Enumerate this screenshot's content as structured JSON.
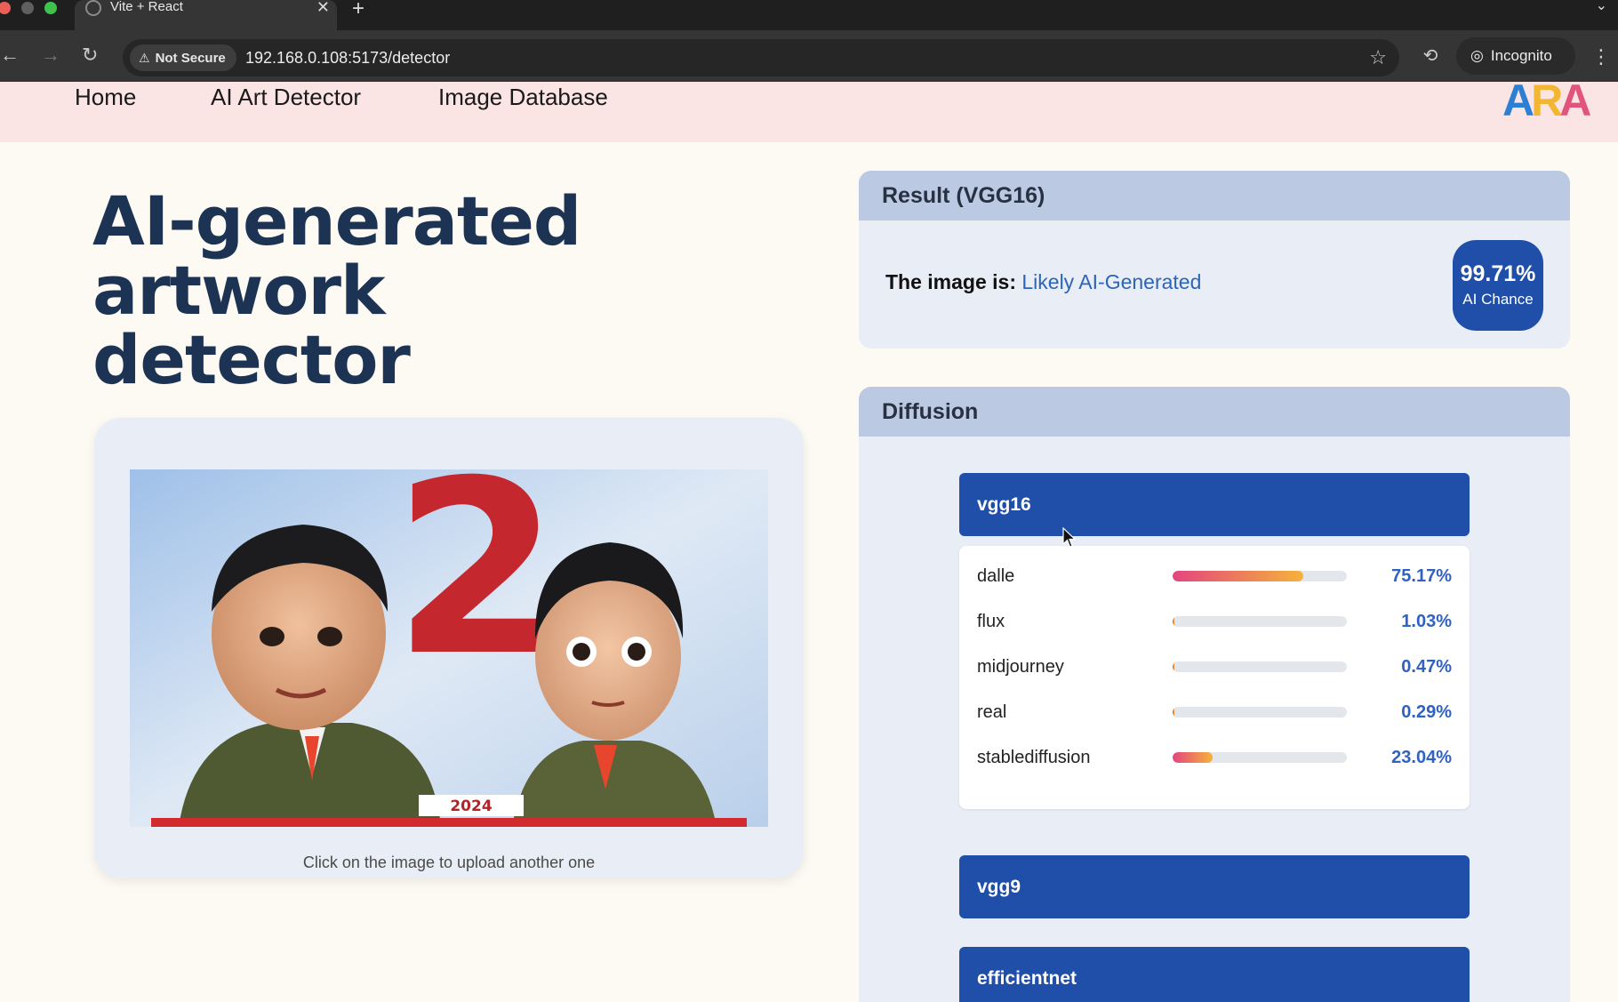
{
  "browser": {
    "tab_title": "Vite + React",
    "tab_close": "✕",
    "new_tab": "+",
    "security_label": "Not Secure",
    "url": "192.168.0.108:5173/detector",
    "profile_label": "Incognito"
  },
  "nav": {
    "links": [
      "Home",
      "AI Art Detector",
      "Image Database"
    ],
    "logo_letters": [
      "A",
      "R",
      "A"
    ]
  },
  "hero": {
    "title_line1": "AI-generated artwork",
    "title_line2": "detector"
  },
  "upload": {
    "artwork_number": "2",
    "artwork_year": "2024",
    "hint": "Click on the image to upload another one"
  },
  "result": {
    "header": "Result (VGG16)",
    "verdict_label": "The image is:",
    "verdict_value": "Likely AI-Generated",
    "chance_value": "99.71%",
    "chance_label": "AI Chance"
  },
  "diffusion": {
    "header": "Diffusion",
    "models": [
      "vgg16",
      "vgg9",
      "efficientnet"
    ],
    "probabilities": [
      {
        "label": "dalle",
        "value": "75.17%",
        "fraction": 0.7517
      },
      {
        "label": "flux",
        "value": "1.03%",
        "fraction": 0.0103
      },
      {
        "label": "midjourney",
        "value": "0.47%",
        "fraction": 0.0047
      },
      {
        "label": "real",
        "value": "0.29%",
        "fraction": 0.0029
      },
      {
        "label": "stablediffusion",
        "value": "23.04%",
        "fraction": 0.2304
      }
    ]
  },
  "colors": {
    "primary_blue": "#1f4fa8",
    "hero_text": "#1c3354",
    "nav_bg": "#fbe4e4",
    "card_bg": "#e8edf6",
    "card_header_bg": "#bcc9e3",
    "verdict_link": "#2e64b6"
  }
}
